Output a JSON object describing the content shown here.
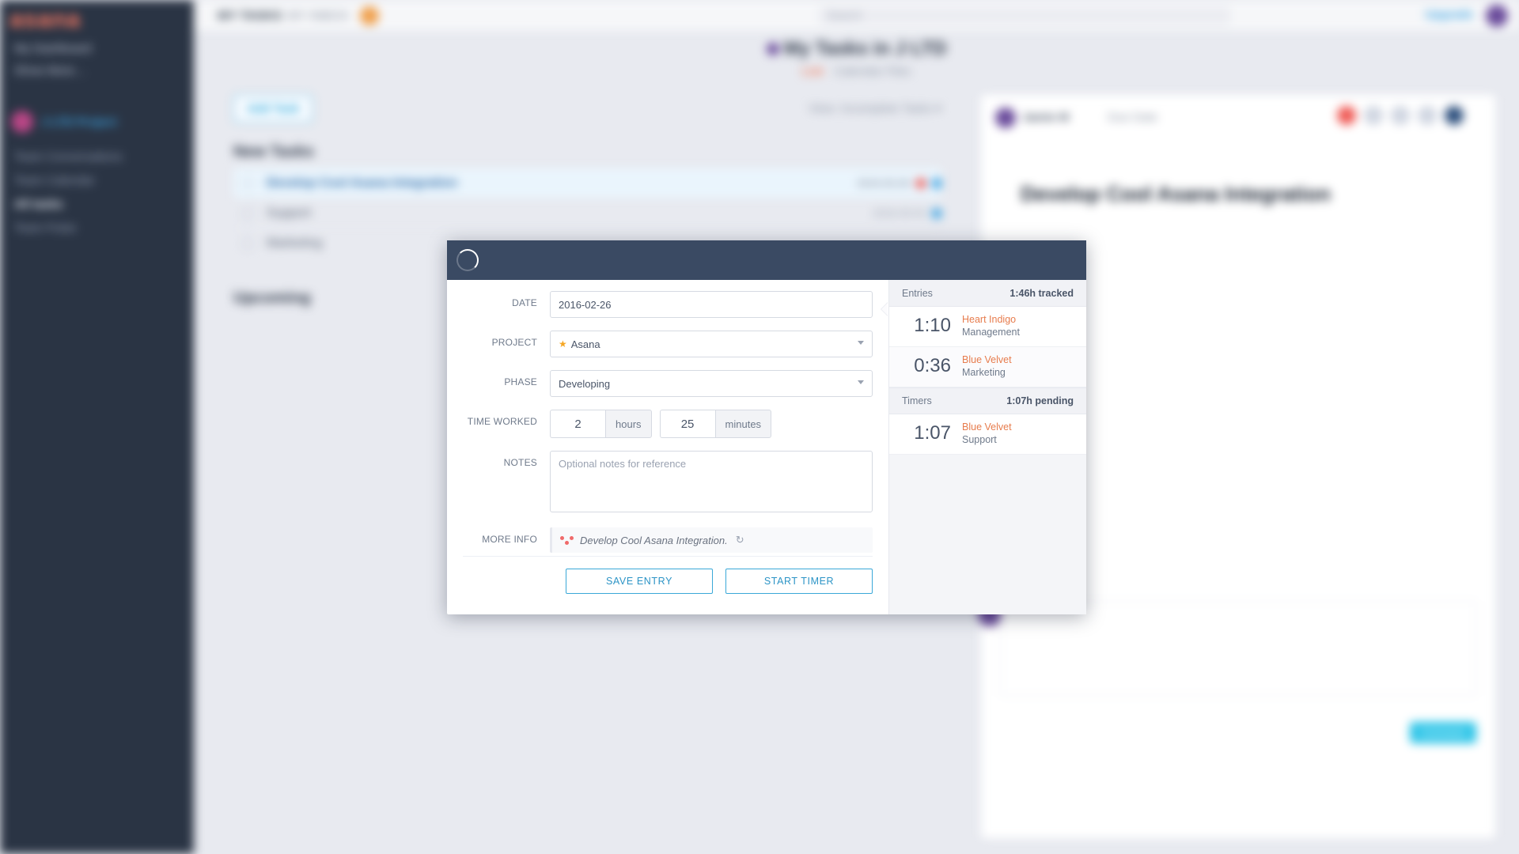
{
  "bg": {
    "brand": "asana",
    "sidebar": {
      "nav1": [
        "My Dashboard",
        "Show More…"
      ],
      "team": "J LTD Project",
      "nav2": [
        "Team Conversations",
        "Team Calendar",
        "All tasks",
        "Team Pulse"
      ]
    },
    "topbar": {
      "t1": "MY TASKS",
      "t2": "MY INBOX",
      "search": "Search",
      "upgrade": "Upgrade"
    },
    "header": {
      "title": "My Tasks in J LTD",
      "tabs": "Calendar    Files",
      "list": "List"
    },
    "list": {
      "add": "Add Task",
      "filter": "View: Incomplete Tasks ▾",
      "section_new": "New Tasks",
      "section_upcoming": "Upcoming",
      "rows": [
        {
          "title": "Develop Cool Asana Integration",
          "right": "2016-02-26"
        },
        {
          "title": "Support",
          "right": "2016-03-04"
        },
        {
          "title": "Marketing",
          "right": ""
        }
      ]
    },
    "detail": {
      "name": "Jamie M",
      "due": "Due Date",
      "title": "Develop Cool Asana Integration"
    }
  },
  "modal": {
    "labels": {
      "date": "DATE",
      "project": "PROJECT",
      "phase": "PHASE",
      "time_worked": "TIME WORKED",
      "notes": "NOTES",
      "more_info": "MORE INFO",
      "hours": "hours",
      "minutes": "minutes"
    },
    "values": {
      "date": "2016-02-26",
      "project": "Asana",
      "phase": "Developing",
      "hours": "2",
      "minutes": "25",
      "notes_placeholder": "Optional notes for reference",
      "more_info_text": "Develop Cool Asana Integration."
    },
    "buttons": {
      "save": "SAVE ENTRY",
      "start": "START TIMER"
    },
    "side": {
      "entries_label": "Entries",
      "entries_summary": "1:46h tracked",
      "entries": [
        {
          "time": "1:10",
          "project": "Heart Indigo",
          "task": "Management"
        },
        {
          "time": "0:36",
          "project": "Blue Velvet",
          "task": "Marketing"
        }
      ],
      "timers_label": "Timers",
      "timers_summary": "1:07h pending",
      "timers": [
        {
          "time": "1:07",
          "project": "Blue Velvet",
          "task": "Support"
        }
      ]
    }
  }
}
